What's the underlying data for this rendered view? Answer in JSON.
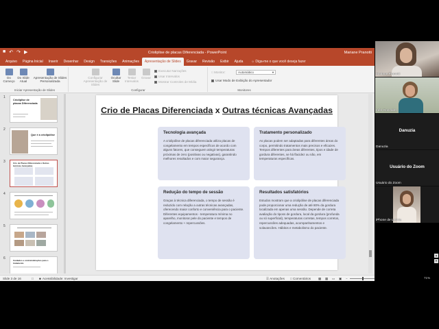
{
  "window": {
    "title": "Crioliplise de placas Diferenciada - PowerPoint",
    "user": "Mariane Pranotti"
  },
  "tabs": [
    "Arquivo",
    "Página Inicial",
    "Inserir",
    "Desenhar",
    "Design",
    "Transições",
    "Animações",
    "Apresentação de Slides",
    "Gravar",
    "Revisão",
    "Exibir",
    "Ajuda"
  ],
  "active_tab": "Apresentação de Slides",
  "tell_me": "Diga-me o que você deseja fazer",
  "ribbon": {
    "start_group_label": "Iniciar Apresentação de Slides",
    "from_start": "Do Começo",
    "from_current": "Do Slide Atual",
    "custom": "Apresentação de Slides Personalizada",
    "setup": "Configurar Apresentação de Slides",
    "hide_slide": "Ocultar Slide",
    "rehearse": "Testar Intervalos",
    "record": "Gravar",
    "configure_group_label": "Configurar",
    "play_narrations": "Executar Narrações",
    "use_timings": "Usar Intervalos",
    "show_media_controls": "Mostrar Controles de Mídia",
    "monitor_label": "Monitor:",
    "monitor_value": "Automático",
    "presenter_view": "Usar Modo de Exibição do Apresentador",
    "monitors_group_label": "Monitores"
  },
  "thumbnails": [
    {
      "num": "1",
      "title": "Crioliplise de placas Diferenciada"
    },
    {
      "num": "2",
      "title": "Que é a criolipólise"
    },
    {
      "num": "3",
      "title": "Crio de Placas Diferenciada x Outras técnicas Avançadas"
    },
    {
      "num": "4",
      "title": ""
    },
    {
      "num": "5",
      "title": ""
    },
    {
      "num": "6",
      "title": "Cuidados e contraindicações para o tratamento"
    }
  ],
  "slide": {
    "title_part1": "Crio de Placas Diferenciada",
    "title_x": "x",
    "title_part2": "Outras técnicas Avançadas",
    "cards": [
      {
        "heading": "Tecnologia avançada",
        "body": "A criolipólise de placas diferenciada utiliza placas de congelamento em tempos específicos de acordo com alguns fatores, que conseguem atingir temperaturas próximas de zero (positivas ou negativas), garantindo melhores resultados e com maior segurança."
      },
      {
        "heading": "Tratamento personalizado",
        "body": "As placas podem ser adaptadas para diferentes áreas do corpo, permitindo tratamentos mais precisos e eficazes. Tempos diferentes para áreas diferentes, tipos e idade de gordura diferentes, se há flacidez ou não, em temperaturas específicas."
      },
      {
        "heading": "Redução do tempo de sessão",
        "body": "Graças à técnica diferenciada, o tempo de sessão é reduzido com relação a outras técnicas avançadas, oferecendo maior conforto e conveniência para o paciente. Diferentes equipamentos - temperatura mínima no aparelho, monitorar pele do paciente e tempos de congelamento + repercussões."
      },
      {
        "heading": "Resultados satisfatórios",
        "body": "Estudos mostram que a criolipólise de placas diferenciada pode proporcionar uma redução de até 80% da gordura localizada em apenas uma sessão. Depende de correta avaliação do tiposs de gordura, local da gordura (profunda ou só superficial), temperaturas corretas, tempos corretos, repercussões adequadas, acompanhamentos e solavancões. Hábitos e metabolismo do paciente."
      }
    ]
  },
  "status": {
    "slide_counter": "Slide 3 de 16",
    "accessibility": "Acessibilidade: Investigar",
    "notes": "Anotações",
    "comments": "Comentários",
    "zoom": "71%"
  },
  "participants": [
    {
      "name": "Mariane Pranotti",
      "type": "video"
    },
    {
      "name": "Inês Gonzales",
      "type": "video"
    },
    {
      "name": "Danuzia",
      "type": "name-only",
      "center": "Danuzia"
    },
    {
      "name": "Usuário do Zoom",
      "type": "name-only",
      "center": "Usuário do Zoom"
    },
    {
      "name": "iPhone de Letícia",
      "type": "video"
    }
  ],
  "colors": {
    "ppt_accent": "#b7472a",
    "card_bg": "#dfe2f0",
    "selected_thumb": "#c0504d"
  }
}
